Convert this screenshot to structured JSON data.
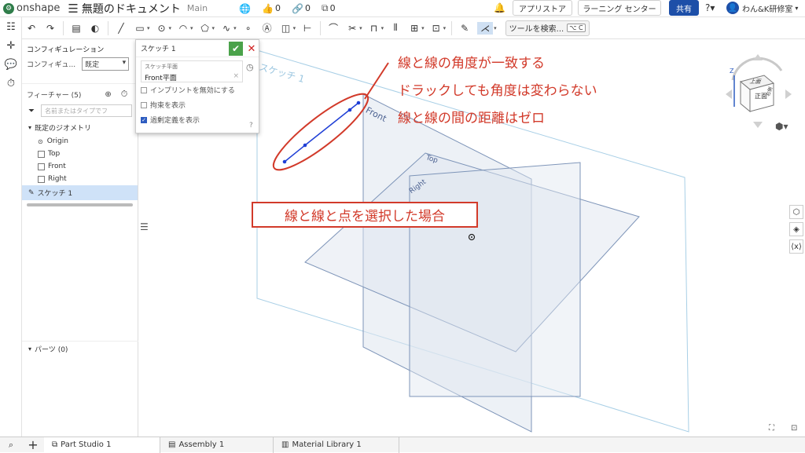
{
  "topbar": {
    "logo": "onshape",
    "doc_title": "無題のドキュメント",
    "branch": "Main",
    "likes": "0",
    "links": "0",
    "copies": "0",
    "appstore": "アプリストア",
    "learning": "ラーニング センター",
    "share": "共有",
    "help": "?",
    "user": "わん&K研修室"
  },
  "toolbar": {
    "search_label": "ツールを検索...",
    "shortcut": "⌥ C"
  },
  "config_panel": {
    "title": "コンフィギュレーション",
    "label": "コンフィギュ...",
    "value": "既定",
    "features_title": "フィーチャー (5)",
    "filter_placeholder": "名前またはタイプでフ",
    "default_geometry": "既定のジオメトリ",
    "items": [
      "Origin",
      "Top",
      "Front",
      "Right"
    ],
    "sketch": "スケッチ 1",
    "parts": "パーツ (0)"
  },
  "sketch_dialog": {
    "title": "スケッチ 1",
    "plane_caption": "スケッチ平面",
    "plane_value": "Front平面",
    "opt1": "インプリントを無効にする",
    "opt2": "拘束を表示",
    "opt3": "過剰定義を表示"
  },
  "viewport": {
    "sketch_label": "スケッチ 1",
    "front_label": "Front",
    "top_label": "Top",
    "right_label": "Right"
  },
  "annotations": {
    "line1": "線と線の角度が一致する",
    "line2": "ドラックしても角度は変わらない",
    "line3": "線と線の間の距離はゼロ",
    "box": "線と線と点を選択した場合"
  },
  "viewcube": {
    "top": "上面",
    "front": "正面",
    "right": "右側",
    "z": "Z",
    "x": "X"
  },
  "tabs": {
    "part_studio": "Part Studio 1",
    "assembly": "Assembly 1",
    "material": "Material Library 1"
  },
  "colors": {
    "accent": "#1d4fa8",
    "annotation": "#d23a2a",
    "ok": "#4aa24a"
  }
}
